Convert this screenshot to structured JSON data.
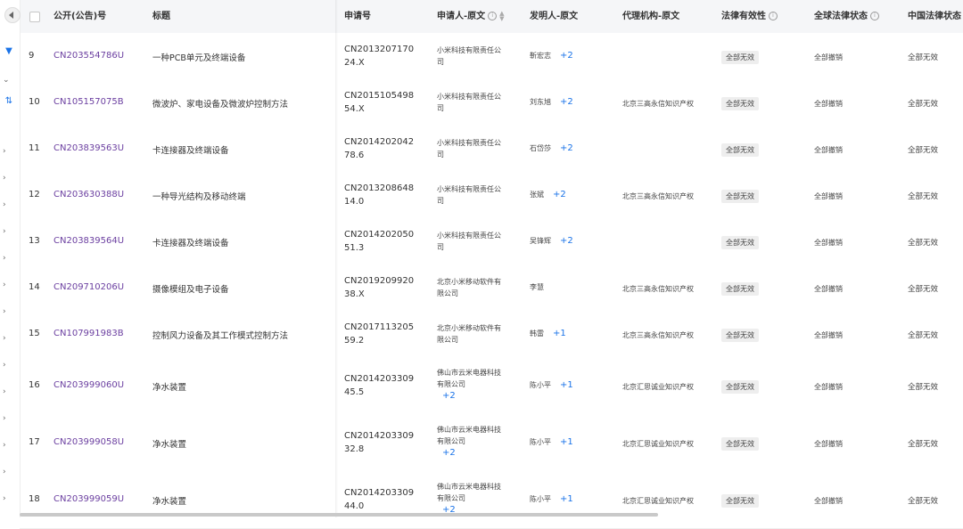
{
  "header": {
    "pub_no": "公开(公告)号",
    "title": "标题",
    "app_no": "申请号",
    "applicant": "申请人-原文",
    "inventor": "发明人-原文",
    "agency": "代理机构-原文",
    "legal_validity": "法律有效性",
    "global_status": "全球法律状态",
    "cn_status": "中国法律状态"
  },
  "rows": [
    {
      "num": "9",
      "pub": "CN203554786U",
      "title": "一种PCB单元及终端设备",
      "app1": "CN2013207170",
      "app2": "24.X",
      "appl1": "小米科技有限责任公",
      "appl2": "司",
      "appl3": "",
      "inv": "靳宏志",
      "more": "+2",
      "agency": "",
      "validity": "全部无效",
      "global": "全部撤销",
      "cn": "全部无效"
    },
    {
      "num": "10",
      "pub": "CN105157075B",
      "title": "微波炉、家电设备及微波炉控制方法",
      "app1": "CN2015105498",
      "app2": "54.X",
      "appl1": "小米科技有限责任公",
      "appl2": "司",
      "appl3": "",
      "inv": "刘东旭",
      "more": "+2",
      "agency": "北京三高永信知识产权",
      "validity": "全部无效",
      "global": "全部撤销",
      "cn": "全部无效"
    },
    {
      "num": "11",
      "pub": "CN203839563U",
      "title": "卡连接器及终端设备",
      "app1": "CN2014202042",
      "app2": "78.6",
      "appl1": "小米科技有限责任公",
      "appl2": "司",
      "appl3": "",
      "inv": "石岱莎",
      "more": "+2",
      "agency": "",
      "validity": "全部无效",
      "global": "全部撤销",
      "cn": "全部无效"
    },
    {
      "num": "12",
      "pub": "CN203630388U",
      "title": "一种导光结构及移动终端",
      "app1": "CN2013208648",
      "app2": "14.0",
      "appl1": "小米科技有限责任公",
      "appl2": "司",
      "appl3": "",
      "inv": "张斌",
      "more": "+2",
      "agency": "北京三高永信知识产权",
      "validity": "全部无效",
      "global": "全部撤销",
      "cn": "全部无效"
    },
    {
      "num": "13",
      "pub": "CN203839564U",
      "title": "卡连接器及终端设备",
      "app1": "CN2014202050",
      "app2": "51.3",
      "appl1": "小米科技有限责任公",
      "appl2": "司",
      "appl3": "",
      "inv": "吴锋辉",
      "more": "+2",
      "agency": "",
      "validity": "全部无效",
      "global": "全部撤销",
      "cn": "全部无效"
    },
    {
      "num": "14",
      "pub": "CN209710206U",
      "title": "摄像模组及电子设备",
      "app1": "CN2019209920",
      "app2": "38.X",
      "appl1": "北京小米移动软件有",
      "appl2": "限公司",
      "appl3": "",
      "inv": "李慧",
      "more": "",
      "agency": "北京三高永信知识产权",
      "validity": "全部无效",
      "global": "全部撤销",
      "cn": "全部无效"
    },
    {
      "num": "15",
      "pub": "CN107991983B",
      "title": "控制风力设备及其工作模式控制方法",
      "app1": "CN2017113205",
      "app2": "59.2",
      "appl1": "北京小米移动软件有",
      "appl2": "限公司",
      "appl3": "",
      "inv": "韩雷",
      "more": "+1",
      "agency": "北京三高永信知识产权",
      "validity": "全部无效",
      "global": "全部撤销",
      "cn": "全部无效"
    },
    {
      "num": "16",
      "pub": "CN203999060U",
      "title": "净水装置",
      "app1": "CN2014203309",
      "app2": "45.5",
      "appl1": "佛山市云米电器科技",
      "appl2": "有限公司",
      "appl3": "+2",
      "inv": "陈小平",
      "more": "+1",
      "agency": "北京汇思诚业知识产权",
      "validity": "全部无效",
      "global": "全部撤销",
      "cn": "全部无效"
    },
    {
      "num": "17",
      "pub": "CN203999058U",
      "title": "净水装置",
      "app1": "CN2014203309",
      "app2": "32.8",
      "appl1": "佛山市云米电器科技",
      "appl2": "有限公司",
      "appl3": "+2",
      "inv": "陈小平",
      "more": "+1",
      "agency": "北京汇思诚业知识产权",
      "validity": "全部无效",
      "global": "全部撤销",
      "cn": "全部无效"
    },
    {
      "num": "18",
      "pub": "CN203999059U",
      "title": "净水装置",
      "app1": "CN2014203309",
      "app2": "44.0",
      "appl1": "佛山市云米电器科技",
      "appl2": "有限公司",
      "appl3": "+2",
      "inv": "陈小平",
      "more": "+1",
      "agency": "北京汇思诚业知识产权",
      "validity": "全部无效",
      "global": "全部撤销",
      "cn": "全部无效"
    }
  ],
  "colors": {
    "link": "#6b3fa0",
    "accent": "#1a73e8",
    "badge_bg": "#eeeeee"
  }
}
